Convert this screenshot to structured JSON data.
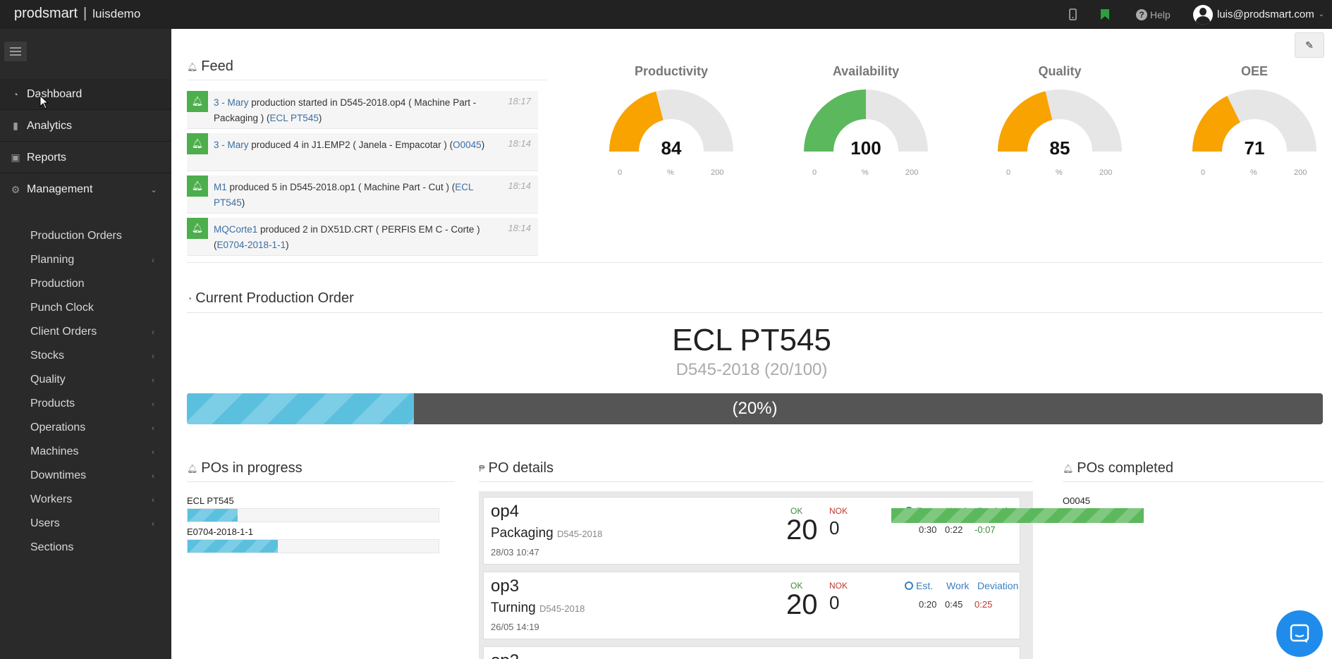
{
  "topbar": {
    "brand": "prodsmart",
    "tenant": "luisdemo",
    "help_label": "Help",
    "user_email": "luis@prodsmart.com"
  },
  "sidebar": {
    "main_items": [
      {
        "label": "Dashboard",
        "icon": "dashboard-icon"
      },
      {
        "label": "Analytics",
        "icon": "bar-chart-icon"
      },
      {
        "label": "Reports",
        "icon": "file-icon"
      },
      {
        "label": "Management",
        "icon": "gears-icon"
      }
    ],
    "sub_items": [
      {
        "label": "Production Orders",
        "has_arrow": false
      },
      {
        "label": "Planning",
        "has_arrow": true
      },
      {
        "label": "Production",
        "has_arrow": false
      },
      {
        "label": "Punch Clock",
        "has_arrow": false
      },
      {
        "label": "Client Orders",
        "has_arrow": true
      },
      {
        "label": "Stocks",
        "has_arrow": true
      },
      {
        "label": "Quality",
        "has_arrow": true
      },
      {
        "label": "Products",
        "has_arrow": true
      },
      {
        "label": "Operations",
        "has_arrow": true
      },
      {
        "label": "Machines",
        "has_arrow": true
      },
      {
        "label": "Downtimes",
        "has_arrow": true
      },
      {
        "label": "Workers",
        "has_arrow": true
      },
      {
        "label": "Users",
        "has_arrow": true
      },
      {
        "label": "Sections",
        "has_arrow": false
      }
    ]
  },
  "feed": {
    "title": "Feed",
    "items": [
      {
        "actor": "3 - Mary",
        "mid": " production started in D545-2018.op4 ( Machine Part - Packaging ) (",
        "ref": "ECL PT545",
        "end": ")",
        "time": "18:17"
      },
      {
        "actor": "3 - Mary",
        "mid": " produced 4 in J1.EMP2 ( Janela - Empacotar ) (",
        "ref": "O0045",
        "end": ")",
        "time": "18:14"
      },
      {
        "actor": "M1",
        "mid": " produced 5 in D545-2018.op1 ( Machine Part - Cut ) (",
        "ref": "ECL PT545",
        "end": ")",
        "time": "18:14"
      },
      {
        "actor": "MQCorte1",
        "mid": " produced 2 in DX51D.CRT ( PERFIS EM C - Corte ) (",
        "ref": "E0704-2018-1-1",
        "end": ")",
        "time": "18:14"
      }
    ]
  },
  "gauges": [
    {
      "title": "Productivity",
      "value": 84,
      "min": "0",
      "unit": "%",
      "max": "200",
      "color": "#f8a300"
    },
    {
      "title": "Availability",
      "value": 100,
      "min": "0",
      "unit": "%",
      "max": "200",
      "color": "#5cb85c"
    },
    {
      "title": "Quality",
      "value": 85,
      "min": "0",
      "unit": "%",
      "max": "200",
      "color": "#f8a300"
    },
    {
      "title": "OEE",
      "value": 71,
      "min": "0",
      "unit": "%",
      "max": "200",
      "color": "#f8a300"
    }
  ],
  "current_po": {
    "title": "Current Production Order",
    "name": "ECL PT545",
    "subtitle": "D545-2018 (20/100)",
    "progress_label": "(20%)",
    "progress": 0.2
  },
  "pos_in_progress": {
    "title": "POs in progress",
    "items": [
      {
        "label": "ECL PT545",
        "progress": 0.2
      },
      {
        "label": "E0704-2018-1-1",
        "progress": 0.36
      }
    ]
  },
  "po_details": {
    "title": "PO details",
    "ok_label": "OK",
    "nok_label": "NOK",
    "est_label": "Est.",
    "work_label": "Work",
    "deviation_label": "Deviation",
    "cards": [
      {
        "op": "op4",
        "name": "Packaging",
        "code": "D545-2018",
        "date": "28/03 10:47",
        "ok": "20",
        "nok": "0",
        "est": "0:30",
        "work": "0:22",
        "deviation": "-0:07",
        "dev_color": "#3c8a3c"
      },
      {
        "op": "op3",
        "name": "Turning",
        "code": "D545-2018",
        "date": "26/05 14:19",
        "ok": "20",
        "nok": "0",
        "est": "0:20",
        "work": "0:45",
        "deviation": "0:25",
        "dev_color": "#c0392b"
      }
    ]
  },
  "pos_completed": {
    "title": "POs completed",
    "items": [
      {
        "label": "O0045",
        "progress": 1
      }
    ]
  }
}
